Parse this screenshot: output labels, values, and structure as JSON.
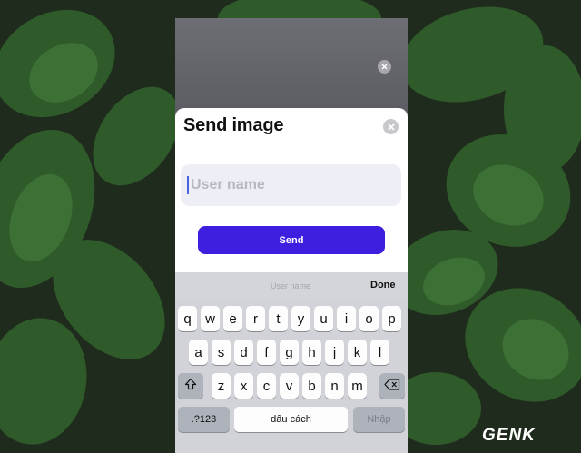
{
  "top_close_icon": "close-icon",
  "sheet": {
    "title": "Send image",
    "close_icon": "close-icon",
    "input_placeholder": "User name",
    "send_label": "Send"
  },
  "keyboard": {
    "accessory_placeholder": "User name",
    "done_label": "Done",
    "row1": [
      "q",
      "w",
      "e",
      "r",
      "t",
      "y",
      "u",
      "i",
      "o",
      "p"
    ],
    "row2": [
      "a",
      "s",
      "d",
      "f",
      "g",
      "h",
      "j",
      "k",
      "l"
    ],
    "row3": [
      "z",
      "x",
      "c",
      "v",
      "b",
      "n",
      "m"
    ],
    "shift_icon": "shift-icon",
    "backspace_icon": "backspace-icon",
    "numbers_label": ".?123",
    "space_label": "dấu cách",
    "return_label": "Nhập"
  },
  "watermark": "GENK",
  "colors": {
    "accent": "#3e1fe0",
    "keyboard_bg": "#d1d3d9"
  }
}
